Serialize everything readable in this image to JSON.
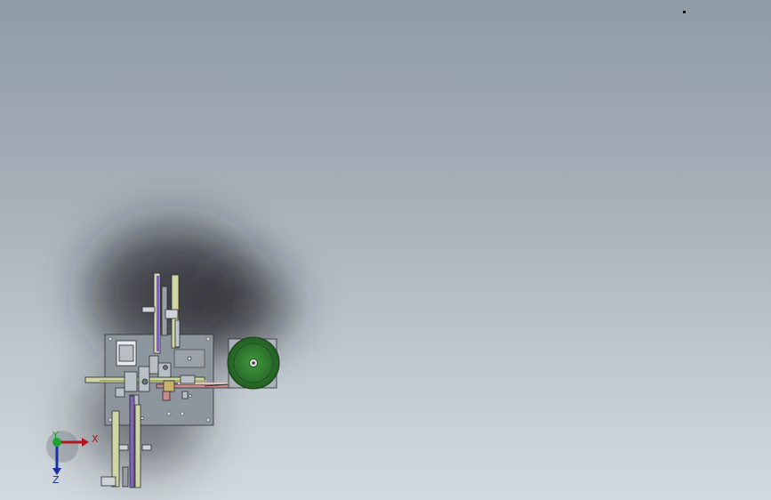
{
  "viewport": {
    "background_top": "#8f9ba6",
    "background_bottom": "#d2d9de"
  },
  "model": {
    "name": "assembly-top-view",
    "plate_color": "#8e969d",
    "reel_color": "#2f7a2f",
    "rail_color": "#cfd6a3",
    "accent_colors": [
      "#7f66b3",
      "#c98a8a",
      "#c9b36a"
    ]
  },
  "triad": {
    "x_label": "X",
    "y_label": "Y",
    "z_label": "Z",
    "x_color": "#b3161b",
    "y_color": "#1fa12c",
    "z_color": "#1b2ea8"
  }
}
